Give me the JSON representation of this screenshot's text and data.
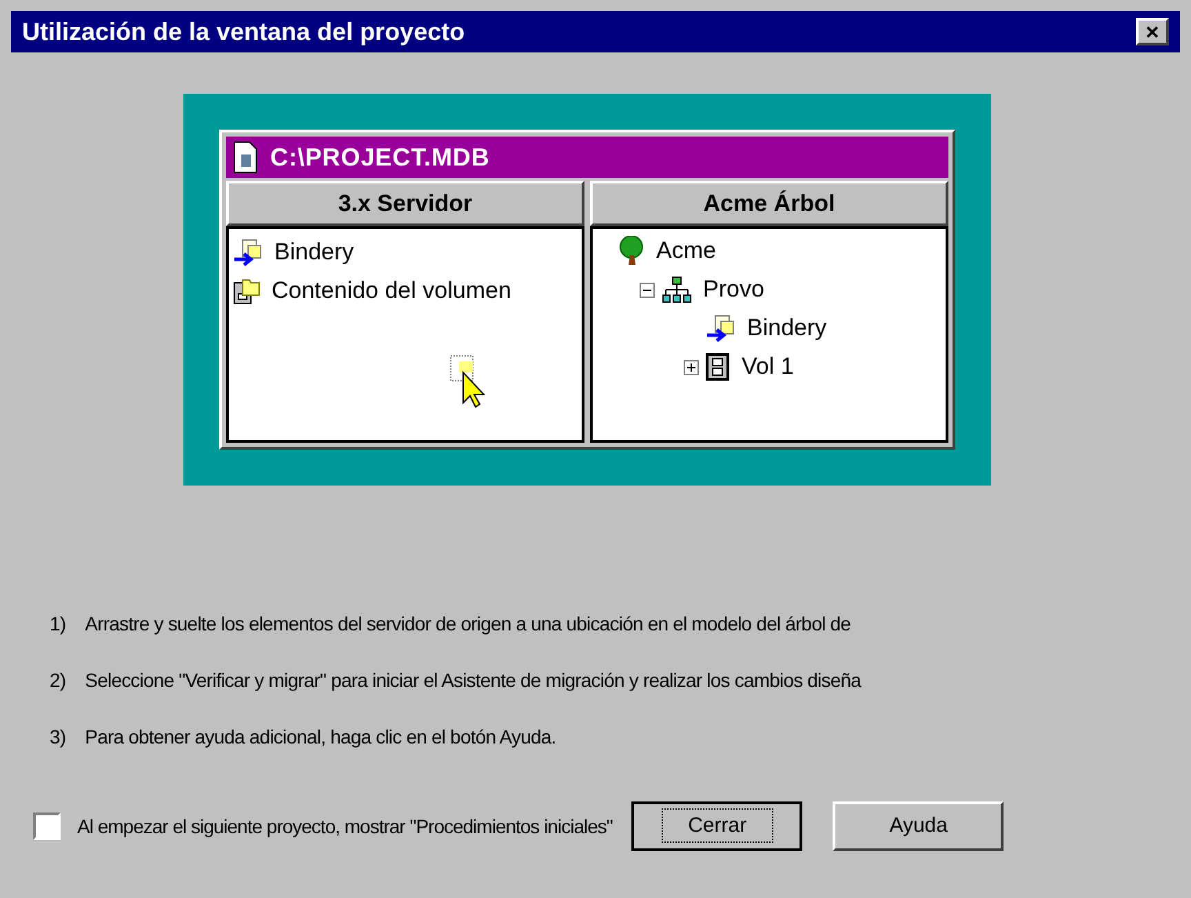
{
  "window": {
    "title": "Utilización de la ventana del proyecto",
    "close": "✕"
  },
  "illustration": {
    "project_title": "C:\\PROJECT.MDB",
    "left_panel": {
      "heading": "3.x Servidor",
      "items": [
        {
          "label": "Bindery",
          "kind": "bindery"
        },
        {
          "label": "Contenido del volumen",
          "kind": "volume"
        }
      ]
    },
    "right_panel": {
      "heading": "Acme Árbol",
      "tree": [
        {
          "label": "Acme",
          "kind": "tree",
          "children": [
            {
              "label": "Provo",
              "kind": "org",
              "expanded": true,
              "children": [
                {
                  "label": "Bindery",
                  "kind": "bindery"
                },
                {
                  "label": "Vol 1",
                  "kind": "drive",
                  "expanded": false
                }
              ]
            }
          ]
        }
      ]
    }
  },
  "steps": [
    {
      "number": "1)",
      "text": "Arrastre y suelte los elementos del servidor de origen a una ubicación en el modelo del árbol de"
    },
    {
      "number": "2)",
      "text": "Seleccione \"Verificar y migrar\" para iniciar el Asistente de migración y realizar los cambios diseña"
    },
    {
      "number": "3)",
      "text": "Para obtener ayuda adicional, haga clic en el botón Ayuda."
    }
  ],
  "startup_checkbox": {
    "label": "Al empezar el siguiente proyecto, mostrar \"Procedimientos iniciales\"",
    "checked": false
  },
  "buttons": [
    {
      "label": "Cerrar",
      "focused": true
    },
    {
      "label": "Ayuda",
      "focused": false
    }
  ]
}
